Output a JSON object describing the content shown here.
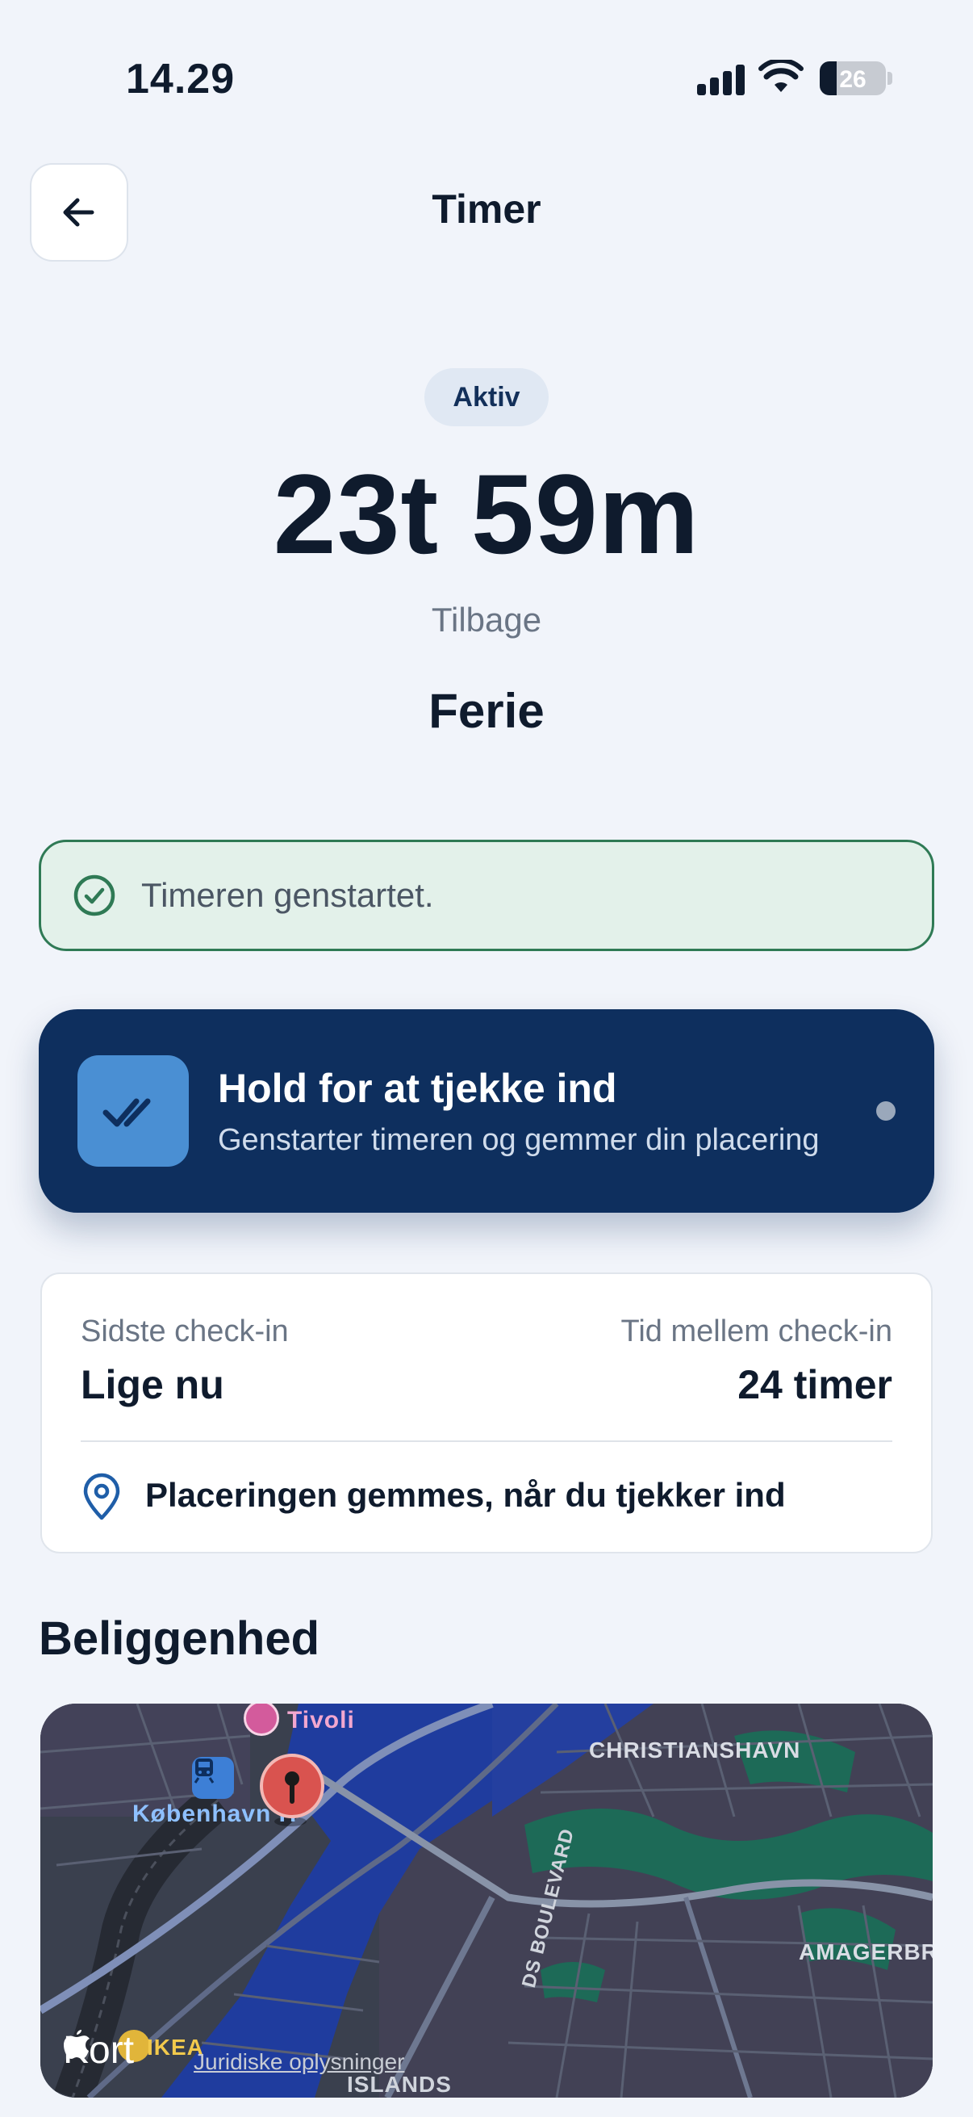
{
  "status_bar": {
    "time": "14.29",
    "battery_level": "26",
    "icons": [
      "cellular-signal-icon",
      "wifi-icon",
      "battery-icon"
    ]
  },
  "header": {
    "title": "Timer",
    "back_icon": "arrow-left-icon"
  },
  "timer": {
    "status": "Aktiv",
    "remaining": "23t 59m",
    "remaining_label": "Tilbage",
    "name": "Ferie"
  },
  "toast": {
    "icon": "check-circle-icon",
    "message": "Timeren genstartet."
  },
  "checkin": {
    "icon": "double-check-icon",
    "title": "Hold for at tjekke ind",
    "subtitle": "Genstarter timeren og gemmer din placering"
  },
  "info": {
    "last_checkin_label": "Sidste check-in",
    "last_checkin_value": "Lige nu",
    "interval_label": "Tid mellem check-in",
    "interval_value": "24 timer",
    "location_icon": "map-pin-icon",
    "location_note": "Placeringen gemmes, når du tjekker ind"
  },
  "location_section": {
    "title": "Beliggenhed",
    "map": {
      "labels": {
        "tivoli": "Tivoli",
        "station": "København H",
        "christianshavn": "CHRISTIANSHAVN",
        "amagerbro": "AMAGERBRO",
        "ikea": "IKEA",
        "boulevard": "DS BOULEVARD",
        "islands": "ISLANDS"
      },
      "attribution": "Kort",
      "legal": "Juridiske oplysninger",
      "pin_icon": "location-pin-icon"
    }
  },
  "colors": {
    "background": "#f1f4fa",
    "primary_dark": "#0e2f5e",
    "accent_blue": "#4a8fd3",
    "success_green": "#2f7a55",
    "pin_red": "#d9534f"
  }
}
